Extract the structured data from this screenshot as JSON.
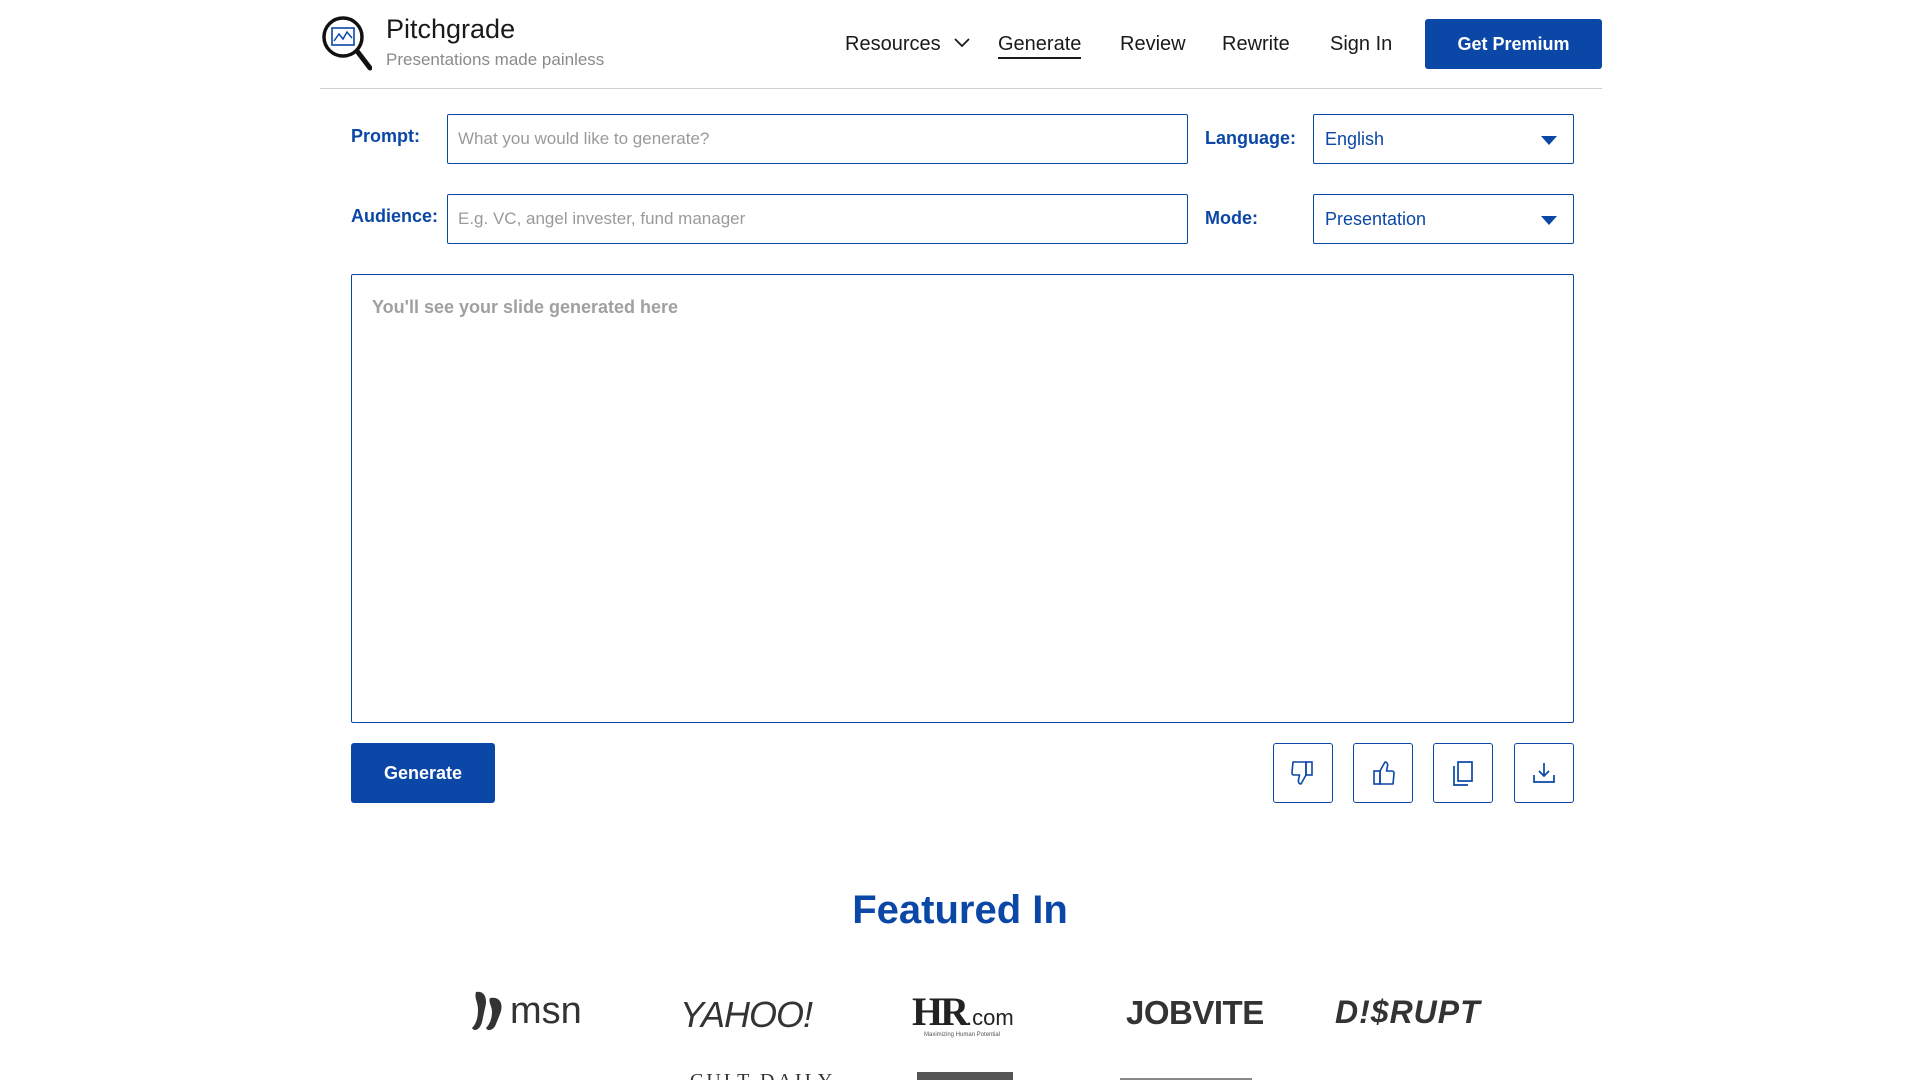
{
  "header": {
    "brand_name": "Pitchgrade",
    "brand_tagline": "Presentations made painless",
    "nav": {
      "resources": "Resources",
      "generate": "Generate",
      "review": "Review",
      "rewrite": "Rewrite",
      "sign_in": "Sign In"
    },
    "premium_button": "Get Premium"
  },
  "form": {
    "prompt_label": "Prompt:",
    "prompt_placeholder": "What you would like to generate?",
    "prompt_value": "",
    "audience_label": "Audience:",
    "audience_placeholder": "E.g. VC, angel invester, fund manager",
    "audience_value": "",
    "language_label": "Language:",
    "language_value": "English",
    "mode_label": "Mode:",
    "mode_value": "Presentation"
  },
  "output": {
    "placeholder": "You'll see your slide generated here"
  },
  "actions": {
    "generate_button": "Generate",
    "icons": [
      "thumbs-down-icon",
      "thumbs-up-icon",
      "copy-icon",
      "download-icon"
    ]
  },
  "featured": {
    "title": "Featured In",
    "logos": {
      "msn": "msn",
      "yahoo": "YAHOO!",
      "hr_main": "HR",
      "hr_suffix": ".com",
      "hr_tagline": "Maximizing Human Potential",
      "jobvite": "JOBVITE",
      "disrupt": "D!$RUPT",
      "cult_daily": "CULT DAILY"
    }
  },
  "colors": {
    "accent": "#0b47a6",
    "placeholder_text": "#9a9a9a",
    "divider": "#cfcfcf"
  }
}
